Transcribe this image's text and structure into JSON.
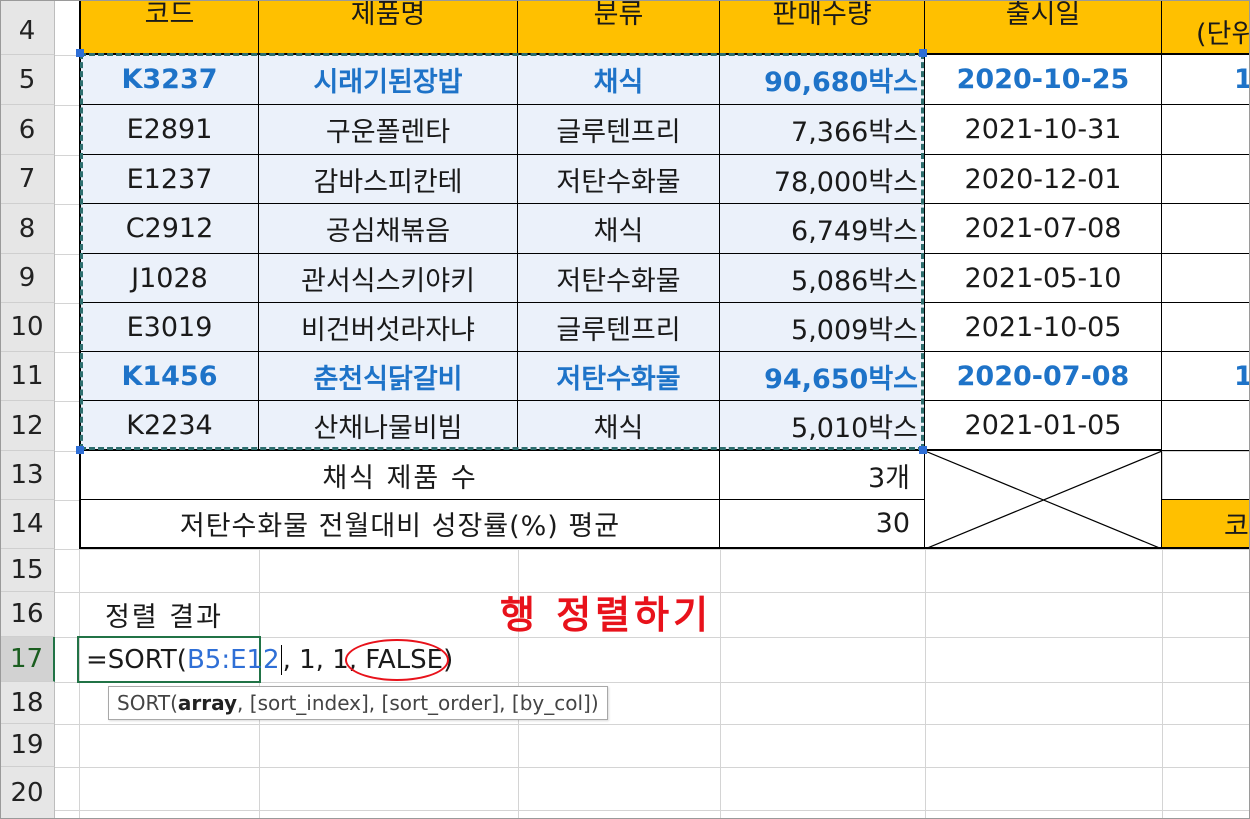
{
  "row_numbers": [
    "4",
    "5",
    "6",
    "7",
    "8",
    "9",
    "10",
    "11",
    "12",
    "13",
    "14",
    "15",
    "16",
    "17",
    "18",
    "19",
    "20"
  ],
  "header": {
    "code": "코드",
    "name": "제품명",
    "category": "분류",
    "sales": "판매수량",
    "release": "출시일",
    "unit_partial": "(단위"
  },
  "rows": [
    {
      "code": "K3237",
      "name": "시래기된장밥",
      "category": "채식",
      "sales": "90,680박스",
      "release": "2020-10-25",
      "extra": "1",
      "highlight": true
    },
    {
      "code": "E2891",
      "name": "구운폴렌타",
      "category": "글루텐프리",
      "sales": "7,366박스",
      "release": "2021-10-31",
      "extra": "",
      "highlight": false
    },
    {
      "code": "E1237",
      "name": "감바스피칸테",
      "category": "저탄수화물",
      "sales": "78,000박스",
      "release": "2020-12-01",
      "extra": "",
      "highlight": false
    },
    {
      "code": "C2912",
      "name": "공심채볶음",
      "category": "채식",
      "sales": "6,749박스",
      "release": "2021-07-08",
      "extra": "",
      "highlight": false
    },
    {
      "code": "J1028",
      "name": "관서식스키야키",
      "category": "저탄수화물",
      "sales": "5,086박스",
      "release": "2021-05-10",
      "extra": "",
      "highlight": false
    },
    {
      "code": "E3019",
      "name": "비건버섯라자냐",
      "category": "글루텐프리",
      "sales": "5,009박스",
      "release": "2021-10-05",
      "extra": "",
      "highlight": false
    },
    {
      "code": "K1456",
      "name": "춘천식닭갈비",
      "category": "저탄수화물",
      "sales": "94,650박스",
      "release": "2020-07-08",
      "extra": "1",
      "highlight": true
    },
    {
      "code": "K2234",
      "name": "산채나물비빔",
      "category": "채식",
      "sales": "5,010박스",
      "release": "2021-01-05",
      "extra": "",
      "highlight": false
    }
  ],
  "summary": {
    "veg_label": "채식 제품 수",
    "veg_value": "3개",
    "lowcarb_label": "저탄수화물 전월대비 성장률(%) 평균",
    "lowcarb_value": "30",
    "partial_right": "코"
  },
  "sort_result_label": "정렬 결과",
  "annotation": "행 정렬하기",
  "formula": {
    "prefix": "=SORT(",
    "range": "B5:E12",
    "middle": ", 1, 1",
    "comma": ",",
    "highlighted_arg": " FALSE",
    "suffix": ")"
  },
  "tooltip": {
    "func": "SORT(",
    "arg1": "array",
    "rest": ", [sort_index], [sort_order], [by_col])"
  },
  "colors": {
    "header_bg": "#ffc000",
    "data_bg": "#ebf1fa",
    "highlight_text": "#1e73c8",
    "annotation_red": "#e8121b",
    "marching_ants": "#2e6f6f",
    "formula_range_blue": "#2f6fd6"
  }
}
